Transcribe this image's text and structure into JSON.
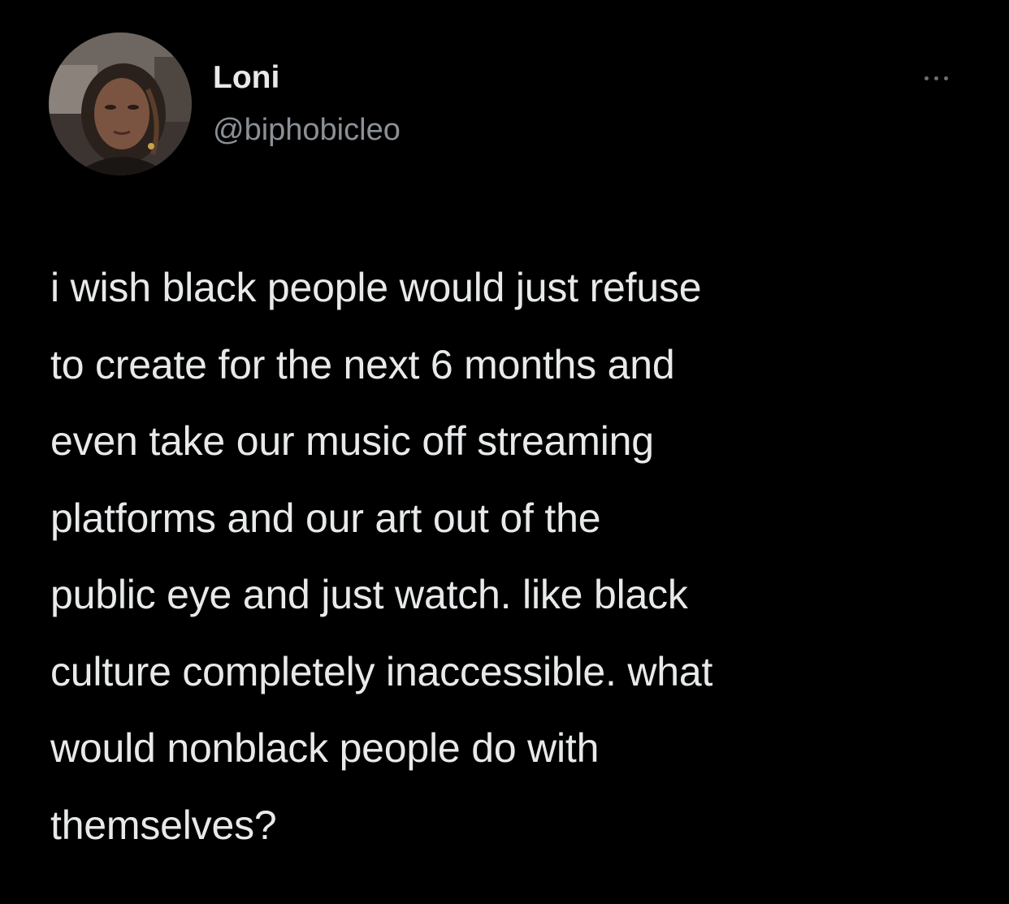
{
  "tweet": {
    "author": {
      "display_name": "Loni",
      "handle": "@biphobicleo",
      "avatar_icon": "profile-photo"
    },
    "more_icon": "more-horizontal-icon",
    "text": "i wish black people would just refuse\nto create for the next 6 months and\neven take our music off streaming\nplatforms and our art out of the\npublic eye and just watch. like black\nculture completely inaccessible. what\nwould nonblack people do with\nthemselves?"
  },
  "colors": {
    "background": "#000000",
    "primary_text": "#e7e9ea",
    "secondary_text": "#8b9096"
  }
}
